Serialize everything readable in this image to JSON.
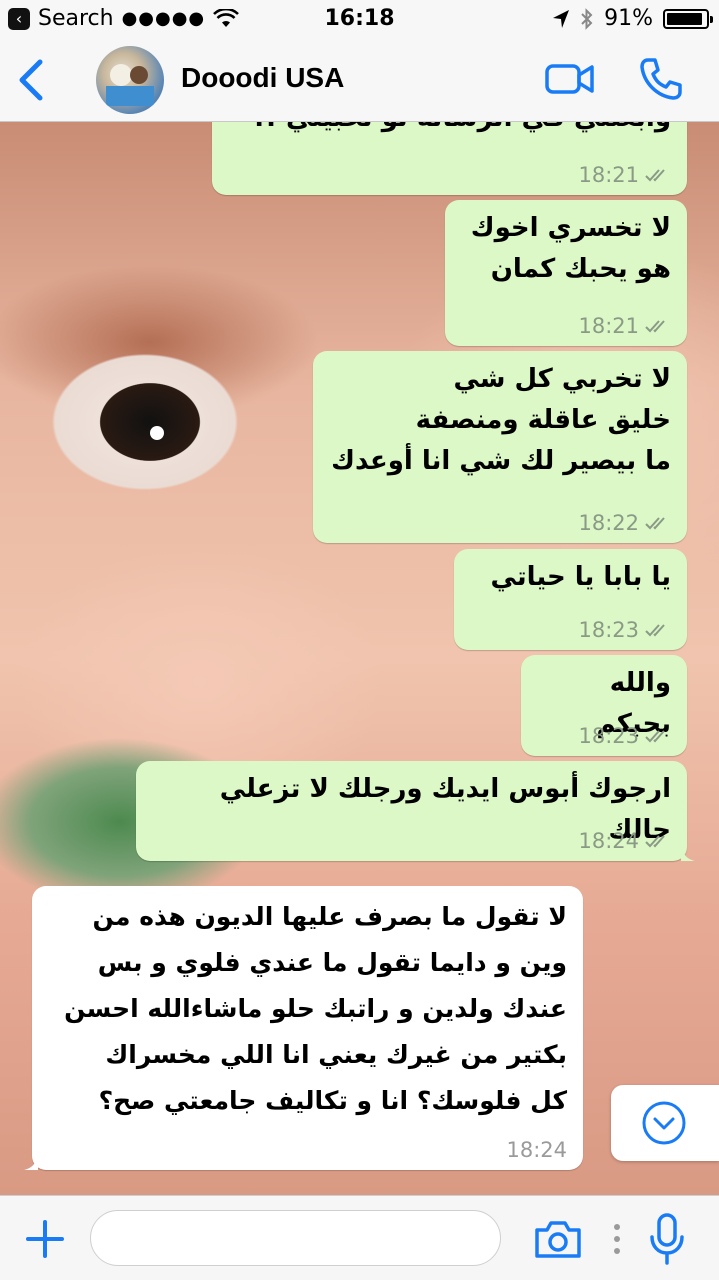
{
  "status_bar": {
    "back_app_label": "Search",
    "signal": "●●●●●",
    "time": "16:18",
    "battery_percent": "91%",
    "battery_level": 0.91
  },
  "header": {
    "contact_name": "Dooodi USA"
  },
  "messages": [
    {
      "direction": "outgoing",
      "text": "وابعتني في الرسالة لو تحبيتي !!",
      "time": "18:21",
      "read_ticks": true
    },
    {
      "direction": "outgoing",
      "text": "لا تخسري اخوك\nهو يحبك كمان",
      "time": "18:21",
      "read_ticks": true
    },
    {
      "direction": "outgoing",
      "text": "لا تخربي كل شي\nخليق عاقلة ومنصفة\nما بيصير لك شي انا أوعدك",
      "time": "18:22",
      "read_ticks": true
    },
    {
      "direction": "outgoing",
      "text": "يا بابا يا حياتي",
      "time": "18:23",
      "read_ticks": true
    },
    {
      "direction": "outgoing",
      "text": "والله بحبكم",
      "time": "18:23",
      "read_ticks": true
    },
    {
      "direction": "outgoing",
      "text": "ارجوك أبوس ايديك ورجلك لا تزعلي حالك",
      "time": "18:24",
      "read_ticks": true
    },
    {
      "direction": "incoming",
      "text": "لا تقول ما بصرف عليها الديون هذه من\nوين و دايما تقول ما عندي فلوي و بس\nعندك ولدين و راتبك حلو ماشاءالله احسن\nبكتير من غيرك يعني انا اللي مخسراك\nكل فلوسك؟ انا و تكاليف جامعتي صح؟",
      "time": "18:24",
      "read_ticks": false
    }
  ],
  "input": {
    "placeholder": "",
    "value": ""
  },
  "colors": {
    "accent": "#1a7cf5",
    "outgoing_bubble": "#dcf8c6",
    "incoming_bubble": "#ffffff",
    "bar_background": "#f7f7f7"
  },
  "icons": {
    "back": "chevron-left-icon",
    "video_call": "video-camera-icon",
    "voice_call": "phone-icon",
    "attach": "plus-icon",
    "camera": "camera-icon",
    "mic": "microphone-icon",
    "scroll_down": "chevron-down-icon"
  }
}
